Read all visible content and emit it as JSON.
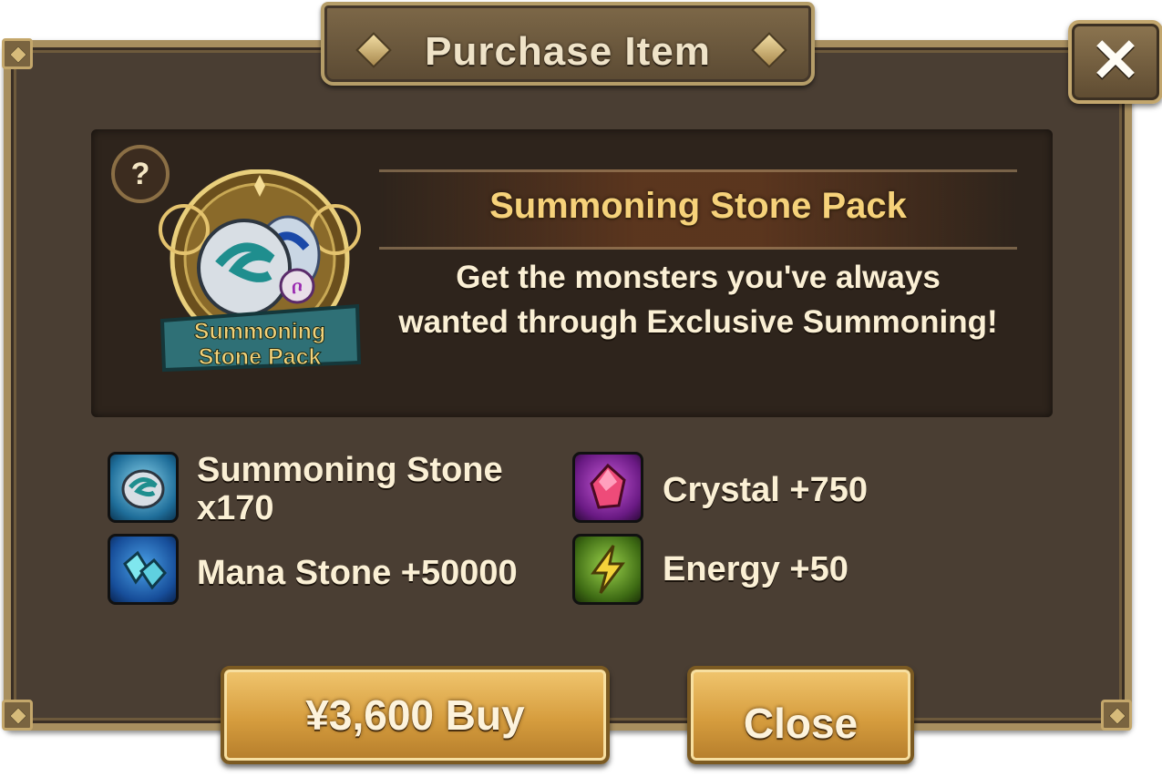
{
  "dialog": {
    "title": "Purchase Item",
    "close_x_label": "✕"
  },
  "item": {
    "help_label": "?",
    "icon_caption_line1": "Summoning",
    "icon_caption_line2": "Stone Pack",
    "name": "Summoning Stone Pack",
    "description": "Get the monsters you've always wanted through Exclusive Summoning!"
  },
  "rewards": [
    {
      "icon": "summoning-stone-icon",
      "label": "Summoning Stone\nx170"
    },
    {
      "icon": "crystal-icon",
      "label": "Crystal +750"
    },
    {
      "icon": "mana-stone-icon",
      "label": "Mana Stone +50000"
    },
    {
      "icon": "energy-icon",
      "label": "Energy +50"
    }
  ],
  "buttons": {
    "buy_label": "¥3,600 Buy",
    "close_label": "Close"
  },
  "colors": {
    "frame": "#4a3e33",
    "border_gold": "#a88f5f",
    "panel": "#2e241c",
    "item_name": "#f6d27a",
    "button_gold": "#d69d3e"
  }
}
